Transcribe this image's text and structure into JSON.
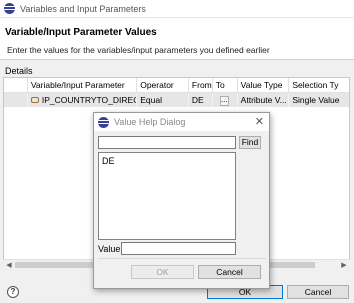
{
  "window": {
    "title": "Variables and Input Parameters"
  },
  "header": {
    "title": "Variable/Input Parameter Values",
    "subtitle": "Enter the values for the variables/input parameters you defined earlier"
  },
  "details": {
    "label": "Details",
    "columns": [
      "",
      "Variable/Input Parameter",
      "Operator",
      "From",
      "To",
      "Value Type",
      "Selection Ty"
    ],
    "row": {
      "parameter": "IP_COUNTRYTO_DIRECT",
      "operator": "Equal",
      "from": "DE",
      "to_button": "...",
      "value_type": "Attribute V...",
      "selection_type": "Single Value"
    }
  },
  "footer": {
    "help_icon": "?",
    "ok_label": "OK",
    "cancel_label": "Cancel"
  },
  "dialog": {
    "title": "Value Help Dialog",
    "close_glyph": "✕",
    "search_value": "",
    "find_label": "Find",
    "list_items": [
      "DE"
    ],
    "value_label": "Value:",
    "value_input": "",
    "ok_label": "OK",
    "cancel_label": "Cancel"
  }
}
